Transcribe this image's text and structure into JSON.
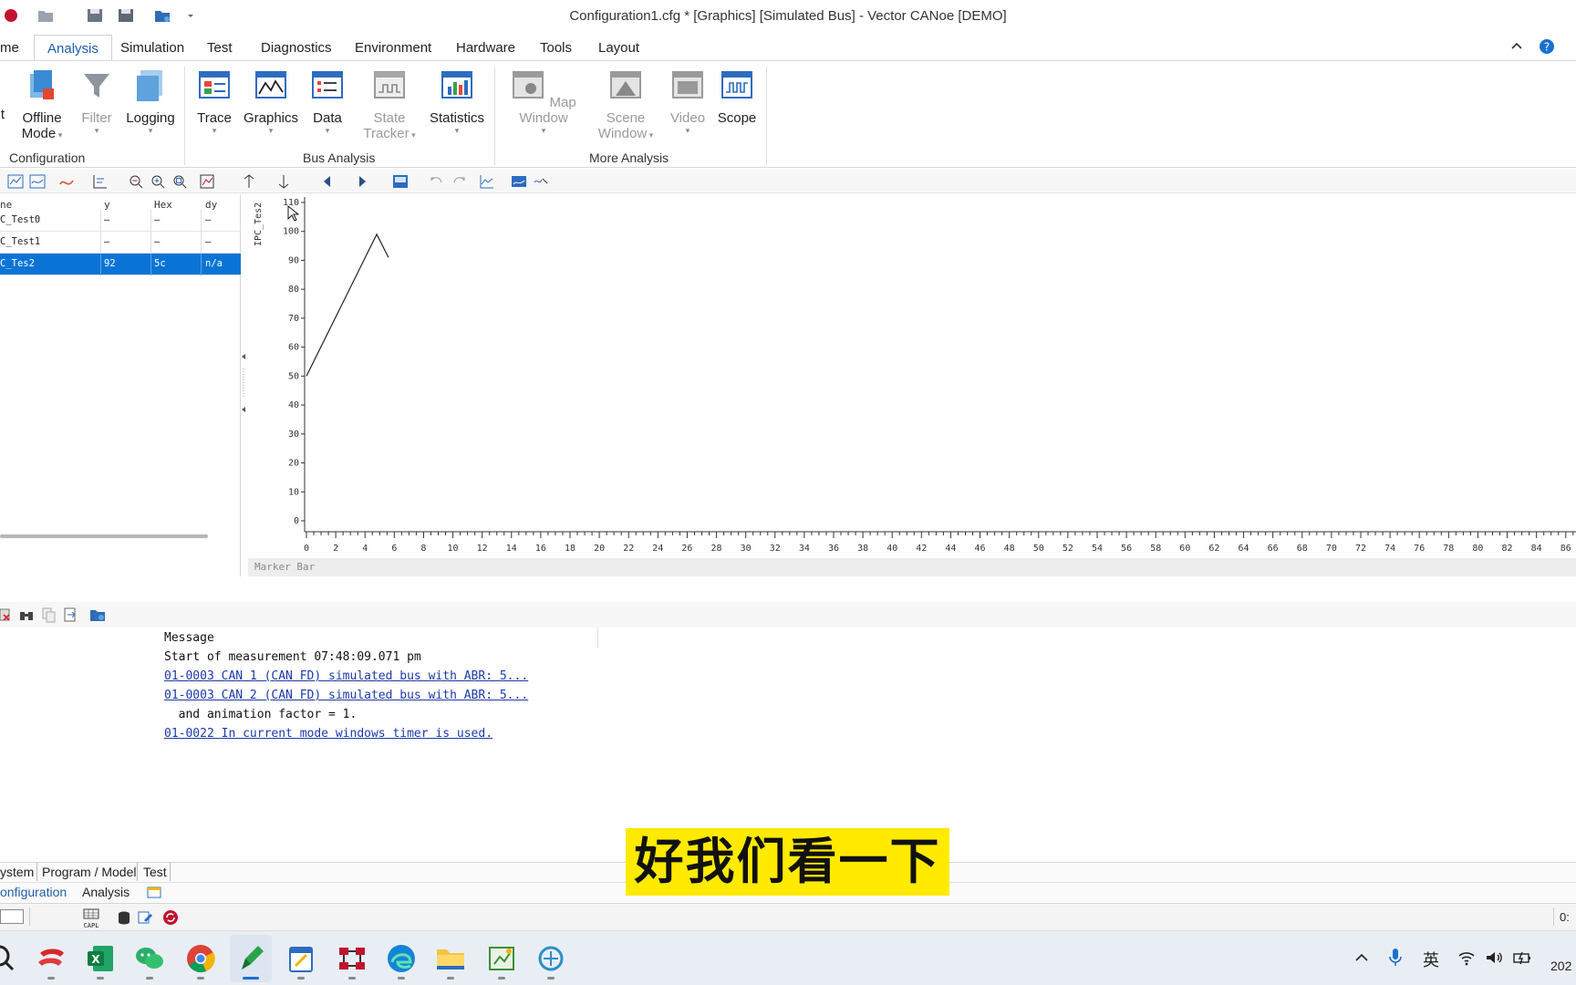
{
  "window": {
    "title": "Configuration1.cfg * [Graphics] [Simulated Bus] - Vector CANoe [DEMO]"
  },
  "ribbon": {
    "tabs": [
      "me",
      "Analysis",
      "Simulation",
      "Test",
      "Diagnostics",
      "Environment",
      "Hardware",
      "Tools",
      "Layout"
    ],
    "active_tab": "Analysis",
    "buttons": {
      "partial": "t",
      "offline_mode": [
        "Offline",
        "Mode"
      ],
      "filter": "Filter",
      "logging": "Logging",
      "trace": "Trace",
      "graphics": "Graphics",
      "data": "Data",
      "state_tracker": [
        "State",
        "Tracker"
      ],
      "statistics": "Statistics",
      "map_window": "Map Window",
      "scene_window": [
        "Scene",
        "Window"
      ],
      "video": "Video",
      "scope": "Scope"
    },
    "groups": {
      "configuration": "Configuration",
      "bus_analysis": "Bus Analysis",
      "more_analysis": "More Analysis"
    }
  },
  "signal_list": {
    "headers": {
      "name": "ne",
      "y": "y",
      "hex": "Hex",
      "dy": "dy"
    },
    "rows": [
      {
        "name": "C_Test0",
        "y": "–",
        "hex": "–",
        "dy": "–",
        "selected": false
      },
      {
        "name": "C_Test1",
        "y": "–",
        "hex": "–",
        "dy": "–",
        "selected": false
      },
      {
        "name": "C_Tes2",
        "y": "92",
        "hex": "5c",
        "dy": "n/a",
        "selected": true
      }
    ]
  },
  "chart_data": {
    "type": "line",
    "ylabel": "IPC_Tes2",
    "yticks": [
      0,
      10,
      20,
      30,
      40,
      50,
      60,
      70,
      80,
      90,
      100,
      110
    ],
    "xticks": [
      0,
      2,
      4,
      6,
      8,
      10,
      12,
      14,
      16,
      18,
      20,
      22,
      24,
      26,
      28,
      30,
      32,
      34,
      36,
      38,
      40,
      42,
      44,
      46,
      48,
      50,
      52,
      54,
      56,
      58,
      60,
      62,
      64,
      66,
      68,
      70,
      72,
      74,
      76,
      78,
      80,
      82,
      84,
      86
    ],
    "xlim": [
      0,
      86.7
    ],
    "ylim": [
      0,
      110
    ],
    "series": [
      {
        "x": [
          0,
          4.8,
          5.6
        ],
        "y": [
          50,
          99,
          91
        ]
      }
    ],
    "line_color": "#222222"
  },
  "marker_bar": "Marker Bar",
  "write_window": {
    "header": "Message",
    "lines": [
      {
        "text": "Start of measurement 07:48:09.071 pm",
        "link": false
      },
      {
        "text": "01-0003 CAN 1 (CAN FD)  simulated bus with ABR: 5...",
        "link": true
      },
      {
        "text": "01-0003 CAN 2 (CAN FD)  simulated bus with ABR: 5...",
        "link": true
      },
      {
        "text": "  and animation factor = 1.",
        "link": false
      },
      {
        "text": "01-0022 In current mode windows timer is used.",
        "link": true
      }
    ]
  },
  "bottom_tabs_1": [
    "ystem",
    "Program / Model",
    "Test"
  ],
  "bottom_tabs_2": [
    "onfiguration",
    "Analysis"
  ],
  "status": {
    "capl": "CAPL",
    "right_time": "0:"
  },
  "taskbar": {
    "ime": "英",
    "clock": "202"
  },
  "subtitle": "好我们看一下"
}
